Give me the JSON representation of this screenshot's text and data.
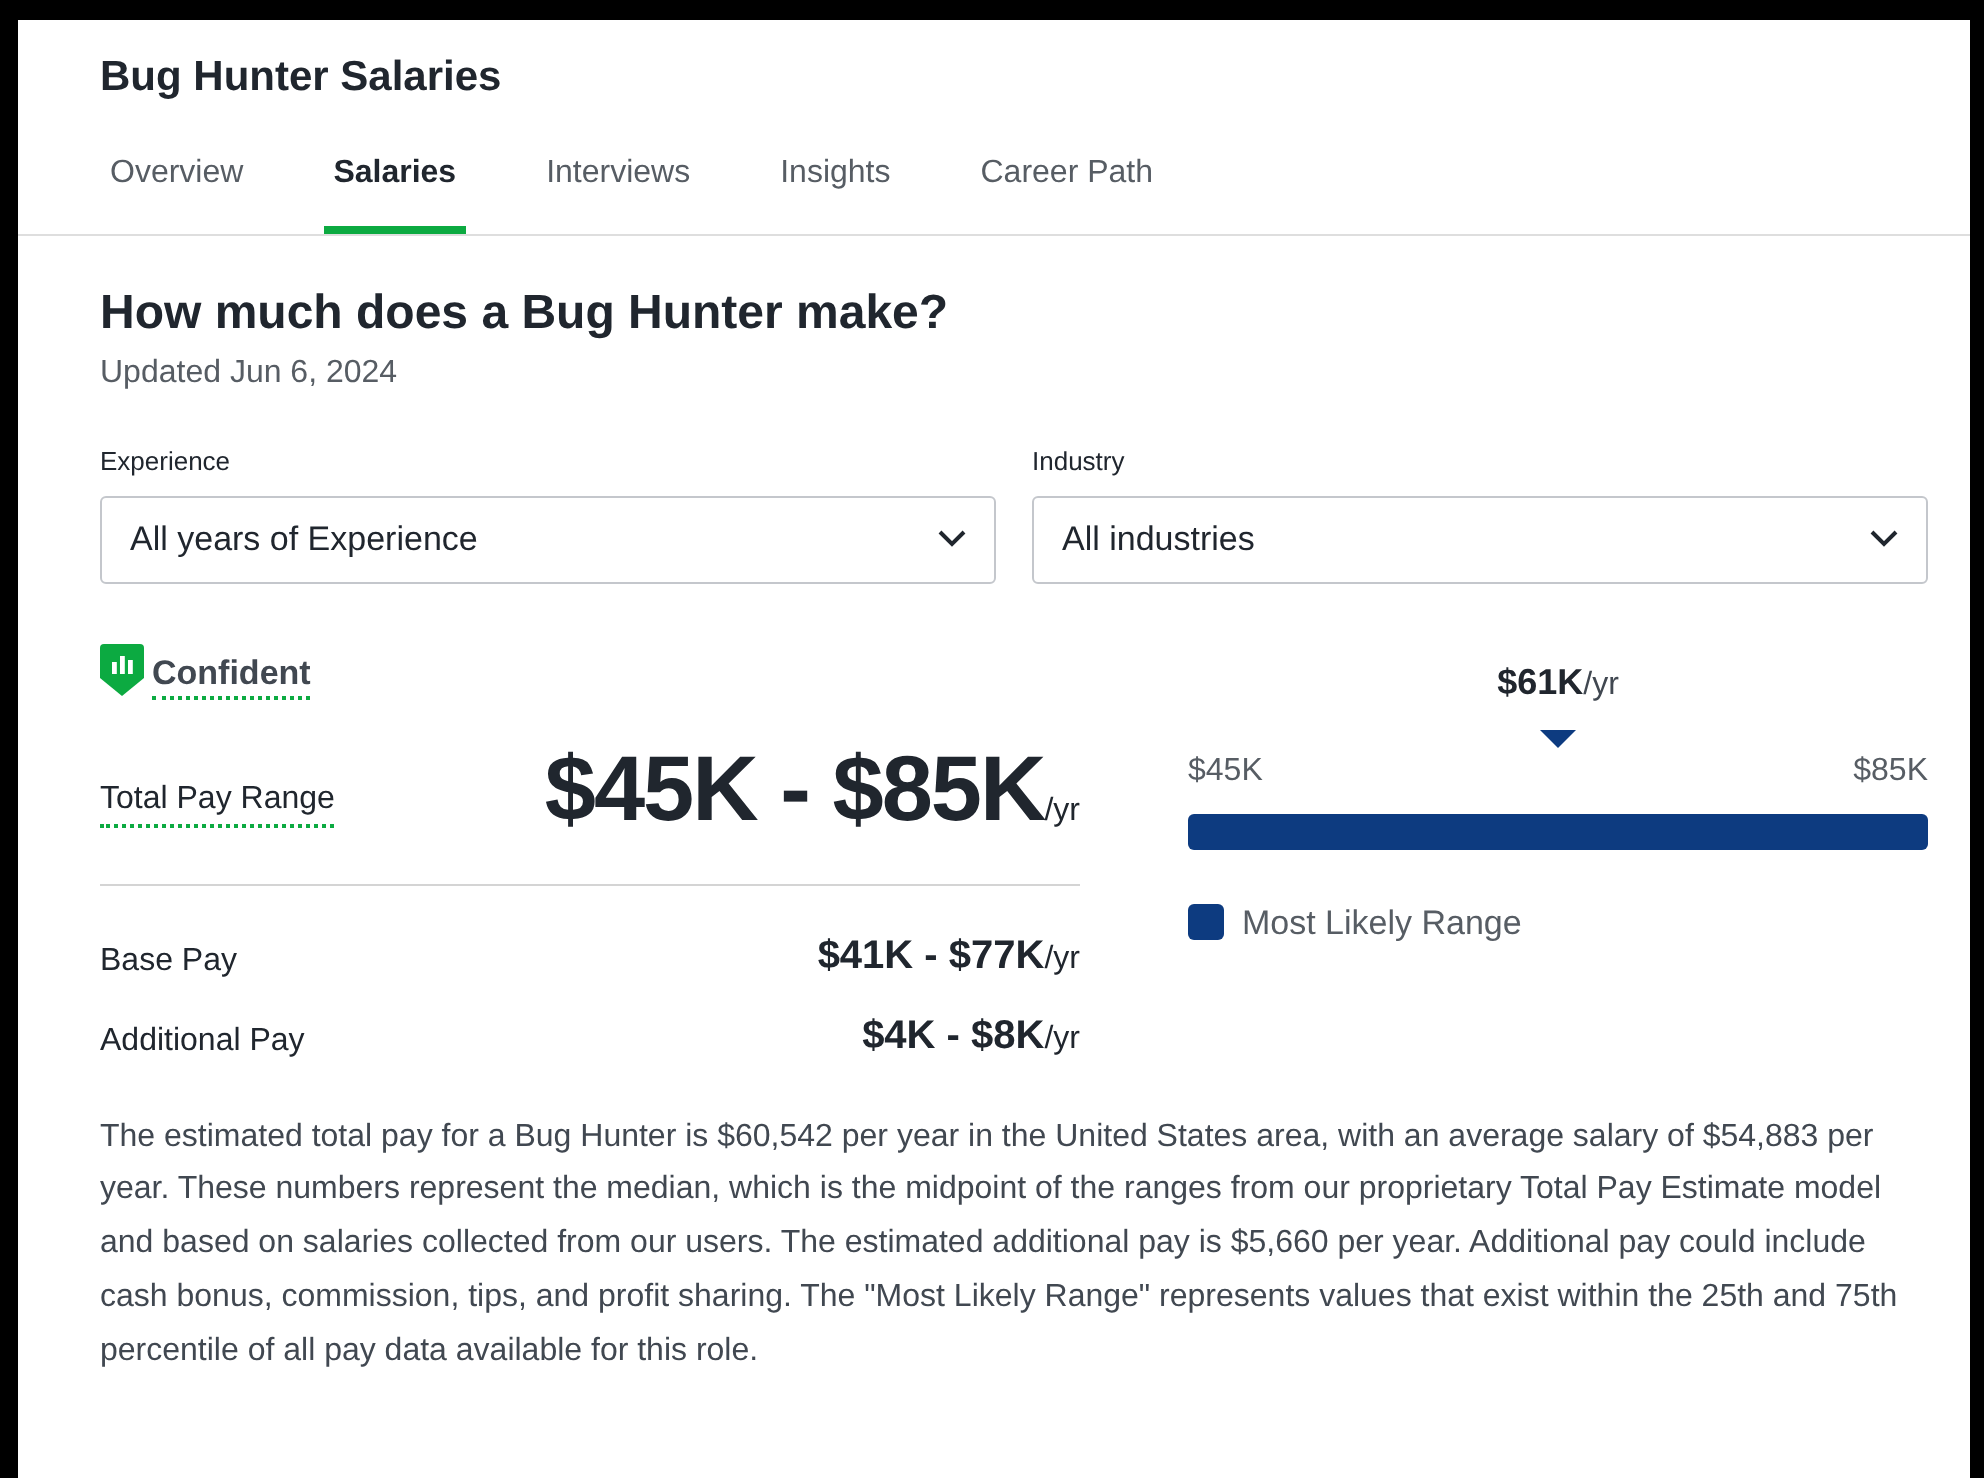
{
  "page_title": "Bug Hunter Salaries",
  "tabs": [
    {
      "label": "Overview",
      "selected": false
    },
    {
      "label": "Salaries",
      "selected": true
    },
    {
      "label": "Interviews",
      "selected": false
    },
    {
      "label": "Insights",
      "selected": false
    },
    {
      "label": "Career Path",
      "selected": false
    }
  ],
  "heading": "How much does a Bug Hunter make?",
  "updated": "Updated Jun 6, 2024",
  "filters": [
    {
      "label": "Experience",
      "value": "All years of Experience"
    },
    {
      "label": "Industry",
      "value": "All industries"
    }
  ],
  "confidence": "Confident",
  "total_pay": {
    "label": "Total Pay Range",
    "value": "$45K - $85K",
    "unit": "/yr"
  },
  "pay_rows": [
    {
      "label": "Base Pay",
      "value": "$41K - $77K",
      "unit": "/yr"
    },
    {
      "label": "Additional Pay",
      "value": "$4K - $8K",
      "unit": "/yr"
    }
  ],
  "range_chart": {
    "median": "$61K",
    "median_unit": "/yr",
    "min": "$45K",
    "max": "$85K",
    "legend": "Most Likely Range"
  },
  "description": "The estimated total pay for a Bug Hunter is $60,542 per year in the United States area, with an average salary of $54,883 per year. These numbers represent the median, which is the midpoint of the ranges from our proprietary Total Pay Estimate model and based on salaries collected from our users. The estimated additional pay is $5,660 per year. Additional pay could include cash bonus, commission, tips, and profit sharing. The \"Most Likely Range\" represents values that exist within the 25th and 75th percentile of all pay data available for this role."
}
